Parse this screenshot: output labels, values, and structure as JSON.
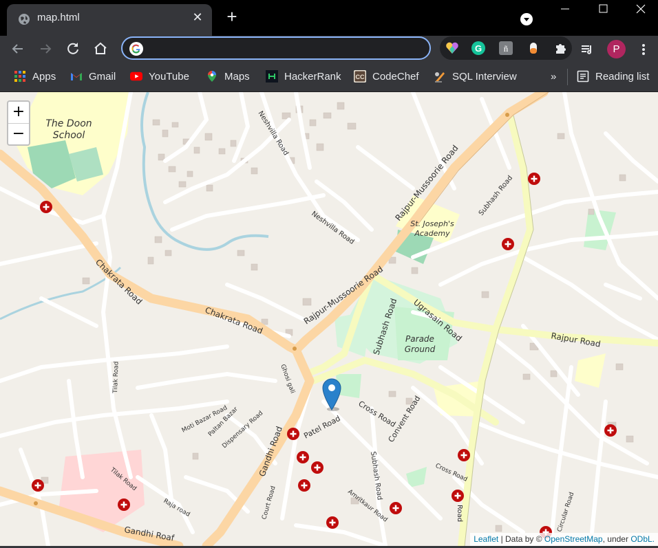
{
  "browser": {
    "tab": {
      "title": "map.html"
    },
    "omnibox": {
      "value": "",
      "placeholder": ""
    },
    "avatar_letter": "P",
    "bookmarks": [
      "Apps",
      "Gmail",
      "YouTube",
      "Maps",
      "HackerRank",
      "CodeChef",
      "SQL Interview"
    ],
    "overflow_label": "»",
    "reading_list": "Reading list"
  },
  "map": {
    "zoom_in": "+",
    "zoom_out": "−",
    "labels": {
      "doon_school_1": "The Doon",
      "doon_school_2": "School",
      "st_josephs_1": "St. Joseph's",
      "st_josephs_2": "Academy",
      "parade_1": "Parade",
      "parade_2": "Ground",
      "rajpur_mussoorie_upper": "Rajpur-Mussoorie Road",
      "rajpur_mussoorie_lower": "Rajpur-Mussoorie Road",
      "neshvilla_1": "Neshvilla Road",
      "neshvilla_2": "Neshvilla Road",
      "chakrata_1": "Chakrata Road",
      "chakrata_2": "Chakrata Road",
      "subhash_1": "Subhash Road",
      "subhash_2": "Subhash Road",
      "subhash_3": "Subhash Road",
      "ugrasain": "Ugrasain Road",
      "rajpur": "Rajpur Road",
      "gandhi_1": "Gandhi Road",
      "gandhi_2": "Gandhi Roaf",
      "tilak_1": "Tilak Road",
      "tilak_2": "Tilak Road",
      "ghosi": "Ghosi gali",
      "moti_bazar": "Moti Bazar Road",
      "paltan_bazar": "Paltan Bazar",
      "dispensary": "Dispensary Road",
      "patel": "Patel Road",
      "cross_1": "Cross Road",
      "cross_2": "Cross Road",
      "convent": "Convent Road",
      "court": "Court Road",
      "amritkaur": "Amritkaur Road",
      "raja": "Raja road",
      "circular": "Circular Road",
      "eastern_road": "Road"
    },
    "attribution": {
      "leaflet": "Leaflet",
      "sep": " | Data by © ",
      "osm": "OpenStreetMap",
      "under": ", under ",
      "odbl": "ODbL."
    },
    "marker_count": 1
  }
}
